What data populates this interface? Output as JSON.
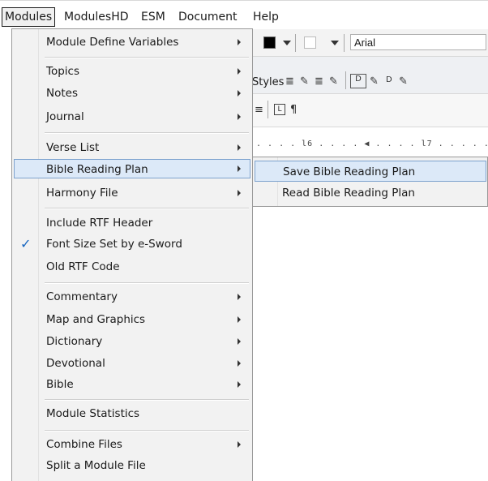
{
  "menubar": {
    "items": [
      "Modules",
      "ModulesHD",
      "ESM",
      "Document",
      "Help"
    ]
  },
  "toolbar": {
    "font_name": "Arial",
    "styles_label": "Styles",
    "text_color": "#000000",
    "highlight_color": "#ffffff"
  },
  "ruler": {
    "marks": ". . . . l6 . . . . ◀ . . . . l7 . . . . . ."
  },
  "menu": {
    "items": [
      {
        "label": "Module Define Variables",
        "submenu": true
      },
      {
        "label": "Topics",
        "submenu": true
      },
      {
        "label": "Notes",
        "submenu": true
      },
      {
        "label": "Journal",
        "submenu": true
      },
      {
        "label": "Verse List",
        "submenu": true
      },
      {
        "label": "Bible Reading Plan",
        "submenu": true,
        "highlighted": true
      },
      {
        "label": "Harmony File",
        "submenu": true
      },
      {
        "label": "Include RTF Header",
        "submenu": false
      },
      {
        "label": "Font Size Set by e-Sword",
        "submenu": false,
        "checked": true
      },
      {
        "label": "Old RTF Code",
        "submenu": false
      },
      {
        "label": "Commentary",
        "submenu": true
      },
      {
        "label": "Map and Graphics",
        "submenu": true
      },
      {
        "label": "Dictionary",
        "submenu": true
      },
      {
        "label": "Devotional",
        "submenu": true
      },
      {
        "label": "Bible",
        "submenu": true
      },
      {
        "label": "Module Statistics",
        "submenu": false
      },
      {
        "label": "Combine Files",
        "submenu": true
      },
      {
        "label": "Split a Module File",
        "submenu": false
      }
    ],
    "check_glyph": "✓"
  },
  "submenu": {
    "items": [
      {
        "label": "Save Bible Reading Plan",
        "highlighted": true
      },
      {
        "label": "Read Bible Reading Plan"
      }
    ]
  },
  "colors": {
    "highlight_bg": "#dce9f8",
    "highlight_border": "#7da2ce",
    "menu_bg": "#f2f2f2",
    "check": "#1565c0"
  }
}
